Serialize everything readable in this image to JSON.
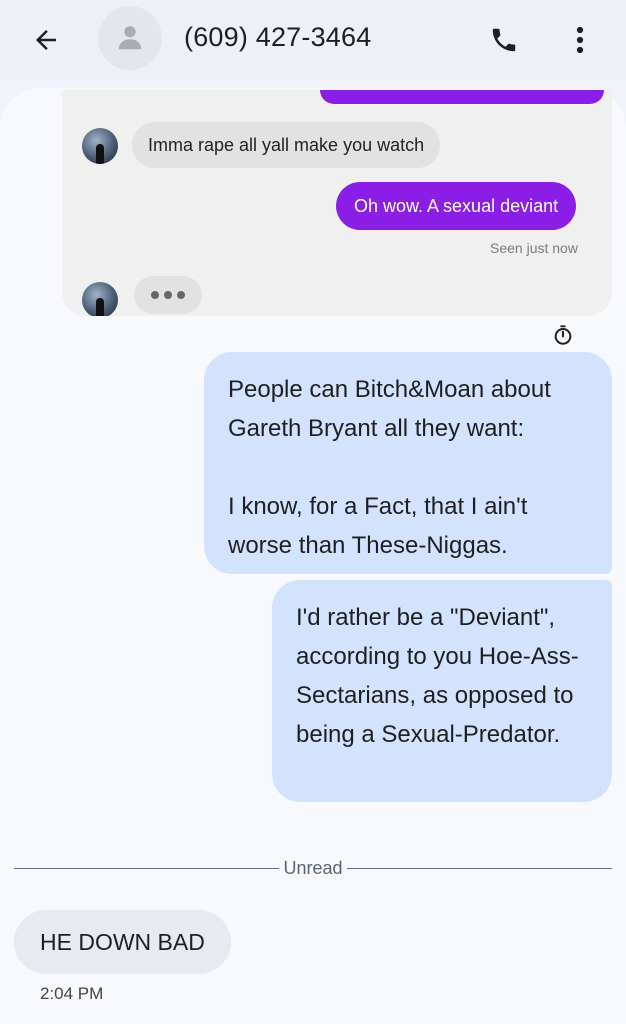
{
  "header": {
    "contact_name": "(609) 427-3464",
    "icons": {
      "back": "arrow-left-icon",
      "avatar": "person-icon",
      "call": "phone-icon",
      "more": "more-vert-icon"
    }
  },
  "embedded_image": {
    "incoming_message": "Imma rape all yall make you watch",
    "outgoing_message": "Oh wow. A sexual deviant",
    "status": "Seen just now",
    "accent_color": "#8a1ee6"
  },
  "messages": {
    "outgoing_1": "People can Bitch&Moan about Gareth Bryant all they want:\n\nI know, for a Fact, that I ain't worse than These-Niggas.",
    "outgoing_2": "I'd rather be a \"Deviant\", according to you Hoe-Ass-Sectarians, as opposed to being a Sexual-Predator.",
    "unread_label": "Unread",
    "incoming_1": "HE DOWN BAD",
    "incoming_1_time": "2:04 PM"
  },
  "colors": {
    "outgoing_bubble": "#d3e3fd",
    "incoming_bubble": "#e8eaf2",
    "background": "#f8f9fd"
  }
}
